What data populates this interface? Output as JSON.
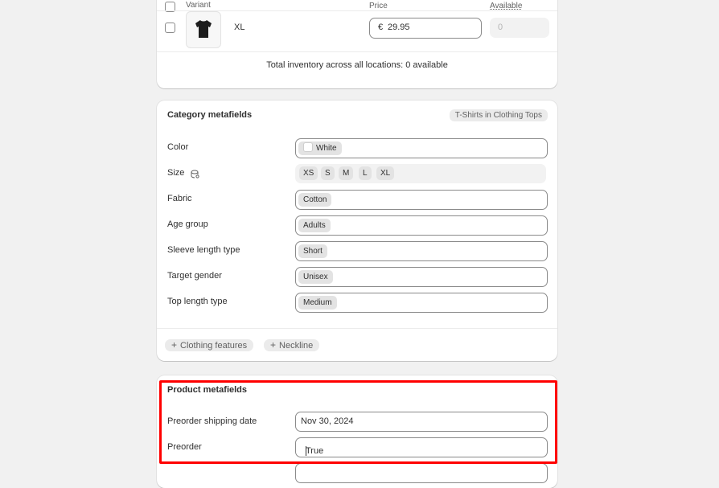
{
  "variants": {
    "header": {
      "variant": "Variant",
      "price": "Price",
      "available": "Available"
    },
    "row": {
      "name": "XL",
      "currency": "€",
      "price": "29.95",
      "available": "0",
      "thumbnail_icon": "tshirt-icon"
    },
    "total_inventory": "Total inventory across all locations: 0 available"
  },
  "category": {
    "title": "Category metafields",
    "category_badge": "T-Shirts in Clothing Tops",
    "fields": [
      {
        "label": "Color",
        "value": "White"
      },
      {
        "label": "Size",
        "values": [
          "XS",
          "S",
          "M",
          "L",
          "XL"
        ]
      },
      {
        "label": "Fabric",
        "value": "Cotton"
      },
      {
        "label": "Age group",
        "value": "Adults"
      },
      {
        "label": "Sleeve length type",
        "value": "Short"
      },
      {
        "label": "Target gender",
        "value": "Unisex"
      },
      {
        "label": "Top length type",
        "value": "Medium"
      }
    ],
    "add_buttons": [
      "Clothing features",
      "Neckline"
    ],
    "colors": {
      "highlight": "#ff0000",
      "chip_bg": "#e3e3e3",
      "page_bg": "#f1f1f1"
    }
  },
  "product": {
    "title": "Product metafields",
    "fields": [
      {
        "label": "Preorder shipping date",
        "value": "Nov 30, 2024"
      },
      {
        "label": "Preorder",
        "value": "True"
      }
    ]
  }
}
